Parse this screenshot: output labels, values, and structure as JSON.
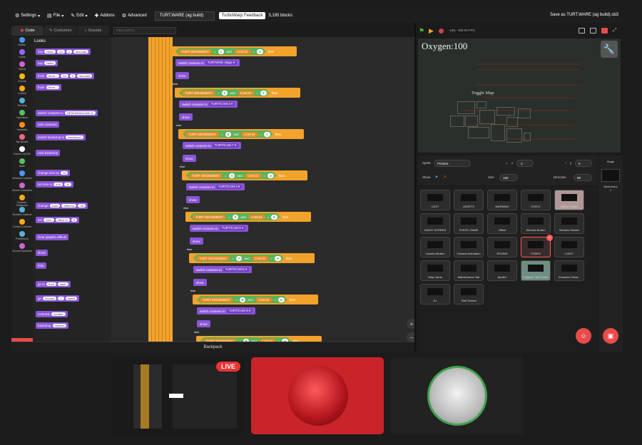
{
  "menubar": {
    "settings": "Settings",
    "file": "File",
    "edit": "Edit",
    "addons": "Addons",
    "advanced": "Advanced",
    "project_title": "TURT.WARE (ag build)",
    "feedback": "TurboWarp Feedback",
    "blocks_count": "3,195 blocks",
    "save_as": "Save as TURT.WARE (ag build).sb3"
  },
  "tabs": [
    {
      "label": "Code",
      "icon": "code-icon"
    },
    {
      "label": "Costumes",
      "icon": "brush-icon"
    },
    {
      "label": "Sounds",
      "icon": "speaker-icon"
    }
  ],
  "search_placeholder": "Find (Ctrl+F)",
  "categories": [
    {
      "label": "Motion",
      "color": "#4c97ff"
    },
    {
      "label": "Looks",
      "color": "#9966ff"
    },
    {
      "label": "Sound",
      "color": "#cf63cf"
    },
    {
      "label": "Events",
      "color": "#ffbf00"
    },
    {
      "label": "Control",
      "color": "#ffab19"
    },
    {
      "label": "Sensing",
      "color": "#5cb1d6"
    },
    {
      "label": "Operators",
      "color": "#59c059"
    },
    {
      "label": "Variables",
      "color": "#ff8c1a"
    },
    {
      "label": "My Blocks",
      "color": "#ff6680"
    },
    {
      "label": "Gamer Jolt API",
      "color": "#ffffff"
    },
    {
      "label": "Math",
      "color": "#59c059"
    },
    {
      "label": "Window Controls",
      "color": "#4c97ff"
    },
    {
      "label": "Screen resolution",
      "color": "#cf63cf"
    },
    {
      "label": "Browser Fullscreen",
      "color": "#ffab19"
    },
    {
      "label": "Runtime Options",
      "color": "#5cb1d6"
    },
    {
      "label": "Control Controls",
      "color": "#ffab19"
    },
    {
      "label": "Pointerlock",
      "color": "#5cb1d6"
    },
    {
      "label": "Sound Expanded",
      "color": "#cf63cf"
    }
  ],
  "palette": {
    "title": "Looks",
    "blocks": [
      {
        "text": "say",
        "slots": [
          "Hello!",
          "for",
          "2",
          "seconds"
        ]
      },
      {
        "text": "say",
        "slots": [
          "Hello!"
        ]
      },
      {
        "text": "think",
        "slots": [
          "Hmm...",
          "for",
          "2",
          "seconds"
        ]
      },
      {
        "text": "think",
        "slots": [
          "Hmm..."
        ]
      },
      {
        "text": "switch costume to",
        "slots": [
          "DESKHEAD/CAM 11"
        ]
      },
      {
        "text": "next costume",
        "slots": []
      },
      {
        "text": "switch backdrop to",
        "slots": [
          "backdrop1"
        ]
      },
      {
        "text": "next backdrop",
        "slots": []
      },
      {
        "text": "change size by",
        "slots": [
          "10"
        ]
      },
      {
        "text": "set size to",
        "slots": [
          "100",
          "%"
        ]
      },
      {
        "text": "change",
        "slots": [
          "color",
          "effect by",
          "25"
        ]
      },
      {
        "text": "set",
        "slots": [
          "color",
          "effect to",
          "0"
        ]
      },
      {
        "text": "clear graphic effects",
        "slots": []
      },
      {
        "text": "show",
        "slots": []
      },
      {
        "text": "hide",
        "slots": []
      },
      {
        "text": "go to",
        "slots": [
          "front",
          "layer"
        ]
      },
      {
        "text": "go",
        "slots": [
          "forward",
          "1",
          "layers"
        ]
      },
      {
        "text": "costume",
        "slots": [
          "number"
        ]
      },
      {
        "text": "backdrop",
        "slots": [
          "number"
        ]
      }
    ]
  },
  "script": {
    "label_else": "else",
    "label_show": "show",
    "label_and": "and",
    "label_then": "then",
    "label_switch": "switch costume to",
    "var_turt": "TURT MOVEMENT",
    "var_cam": "CAM ID",
    "rows": [
      {
        "turt": "1",
        "cam": "1",
        "costume": "TURTWHE stage"
      },
      {
        "turt": "2",
        "cam": "2",
        "costume": "TURT/CAM 2"
      },
      {
        "turt": "3",
        "cam": "7",
        "costume": "TURT/CAM 7"
      },
      {
        "turt": "4",
        "cam": "3",
        "costume": "TURT/CAM 3"
      },
      {
        "turt": "5",
        "cam": "6",
        "costume": "TURT/CAM 6"
      },
      {
        "turt": "7",
        "cam": "5",
        "costume": "TURT/CAM 5"
      },
      {
        "turt": "8",
        "cam": "8",
        "costume": "TURT/CAM 8"
      },
      {
        "turt": "9",
        "cam": "9",
        "costume": ""
      }
    ]
  },
  "backpack": "Backpack",
  "stage": {
    "fps": "-196, -108  60 FPS",
    "oxygen": "Oxygen:100",
    "toggle_map": "Toggle Map"
  },
  "sprite_info": {
    "sprite_label": "Sprite",
    "sprite_name": "POSES",
    "x_label": "x",
    "x_value": "-1",
    "y_label": "y",
    "y_value": "0",
    "show_label": "Show",
    "size_label": "Size",
    "size_value": "100",
    "direction_label": "Direction",
    "direction_value": "90"
  },
  "sprites": [
    "CAST",
    "ASSETS",
    "WARNING",
    "STATIC",
    "MENU Cover",
    "NIGHT SCREEN",
    "STATIC GAME",
    "Office",
    "Window Button",
    "Window Shutter",
    "Camera Button",
    "Camera Animation",
    "ROOMS",
    "POSES",
    "LIGHT",
    "Map Cams",
    "Maintenance Tab",
    "Sprite1",
    "Original Turt's Helio",
    "Character Wind...",
    "A.I",
    "TAM Screen"
  ],
  "stage_panel": {
    "title": "Stage",
    "backdrops_label": "Backdrops",
    "backdrops_count": "1"
  },
  "stream": {
    "live": "LIVE"
  }
}
